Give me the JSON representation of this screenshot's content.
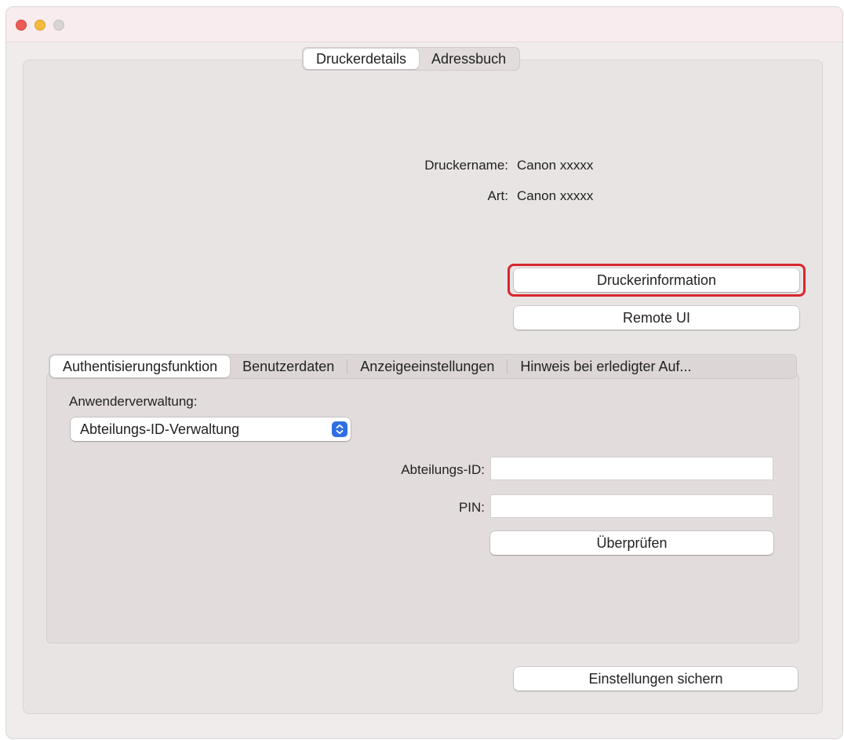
{
  "top_tabs": [
    {
      "label": "Druckerdetails",
      "selected": true
    },
    {
      "label": "Adressbuch",
      "selected": false
    }
  ],
  "printer": {
    "name_label": "Druckername:",
    "name_value": "Canon xxxxx",
    "type_label": "Art:",
    "type_value": "Canon xxxxx"
  },
  "buttons": {
    "printer_info": "Druckerinformation",
    "remote_ui": "Remote UI",
    "verify": "Überprüfen",
    "save_settings": "Einstellungen sichern"
  },
  "inner_tabs": [
    {
      "label": "Authentisierungsfunktion",
      "selected": true
    },
    {
      "label": "Benutzerdaten",
      "selected": false
    },
    {
      "label": "Anzeigeeinstellungen",
      "selected": false
    },
    {
      "label": "Hinweis bei erledigter Auf...",
      "selected": false
    }
  ],
  "auth": {
    "user_management_label": "Anwenderverwaltung:",
    "user_management_value": "Abteilungs-ID-Verwaltung",
    "dept_id_label": "Abteilungs-ID:",
    "dept_id_value": "",
    "pin_label": "PIN:",
    "pin_value": ""
  },
  "colors": {
    "highlight": "#d9262e",
    "select_accent": "#2f6fe0",
    "close": "#ec5b57",
    "minimize": "#f2bb3c",
    "maximize": "#d8d3d4"
  }
}
